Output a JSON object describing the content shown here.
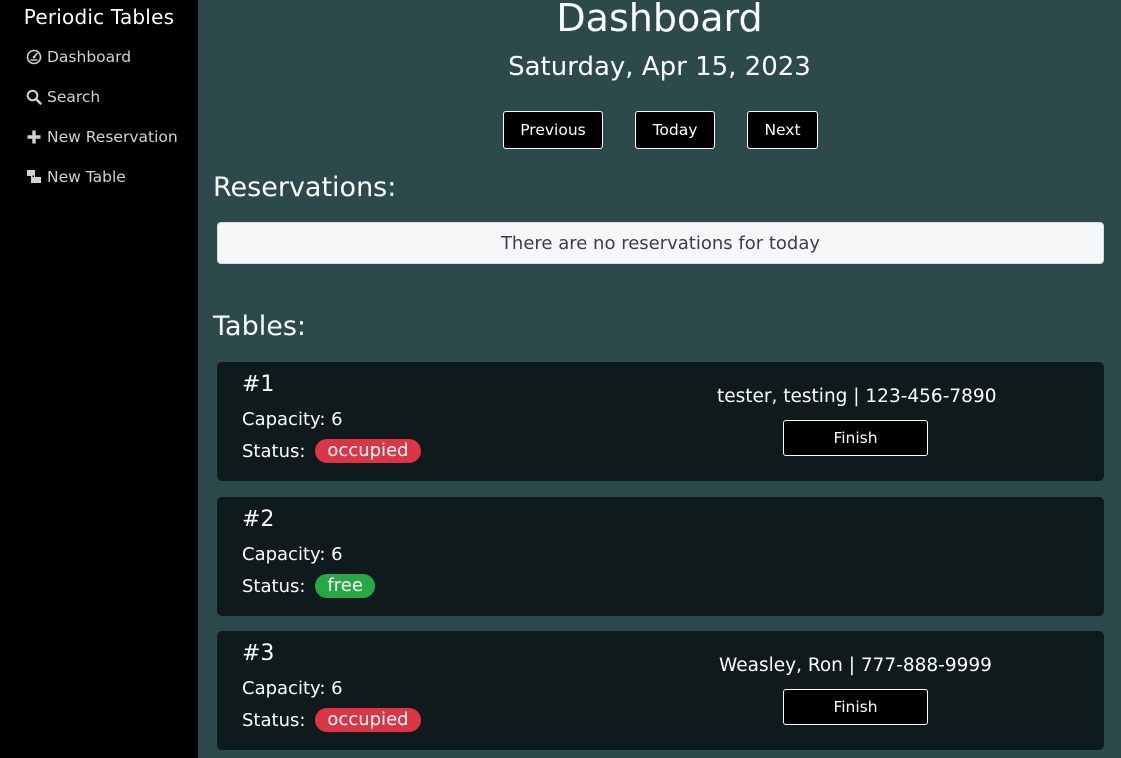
{
  "sidebar": {
    "brand": "Periodic Tables",
    "items": [
      {
        "label": "Dashboard",
        "icon": "dashboard-icon"
      },
      {
        "label": "Search",
        "icon": "search-icon"
      },
      {
        "label": "New Reservation",
        "icon": "plus-icon"
      },
      {
        "label": "New Table",
        "icon": "table-icon"
      }
    ]
  },
  "header": {
    "title": "Dashboard",
    "date": "Saturday, Apr 15, 2023"
  },
  "nav_buttons": {
    "previous": "Previous",
    "today": "Today",
    "next": "Next"
  },
  "reservations": {
    "heading": "Reservations:",
    "empty_message": "There are no reservations for today"
  },
  "tables": {
    "heading": "Tables:",
    "items": [
      {
        "name": "#1",
        "capacity": "Capacity: 6",
        "status_label": "Status:",
        "status": "occupied",
        "reservation": "tester, testing | 123-456-7890",
        "finish_label": "Finish"
      },
      {
        "name": "#2",
        "capacity": "Capacity: 6",
        "status_label": "Status:",
        "status": "free"
      },
      {
        "name": "#3",
        "capacity": "Capacity: 6",
        "status_label": "Status:",
        "status": "occupied",
        "reservation": "Weasley, Ron | 777-888-9999",
        "finish_label": "Finish"
      }
    ]
  },
  "colors": {
    "background": "#2c4a4b",
    "sidebar": "#000000",
    "card": "#0e1a1b",
    "occupied": "#dc3545",
    "free": "#28a745"
  }
}
